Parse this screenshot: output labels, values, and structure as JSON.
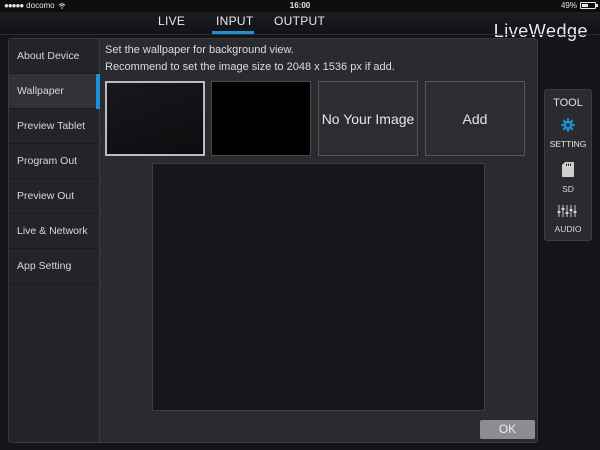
{
  "statusbar": {
    "carrier": "docomo",
    "time": "16:00",
    "battery": "49%"
  },
  "topnav": {
    "tabs": [
      "LIVE",
      "INPUT",
      "OUTPUT"
    ],
    "active_tab": "INPUT",
    "brand": "LiveWedge"
  },
  "sidebar": {
    "items": [
      "About Device",
      "Wallpaper",
      "Preview Tablet",
      "Program Out",
      "Preview Out",
      "Live & Network",
      "App Setting"
    ],
    "active": "Wallpaper"
  },
  "content": {
    "description": "Set the wallpaper for background view.",
    "recommendation": "Recommend to set the image size to 2048 x 1536 px if add.",
    "tiles": [
      "",
      "",
      "No Your Image",
      "Add"
    ],
    "ok_label": "OK"
  },
  "tool": {
    "title": "TOOL",
    "items": [
      "SETTING",
      "SD",
      "AUDIO"
    ]
  },
  "colors": {
    "accent": "#1e90d6",
    "background": "#141518",
    "panel": "#2a2b2e"
  }
}
